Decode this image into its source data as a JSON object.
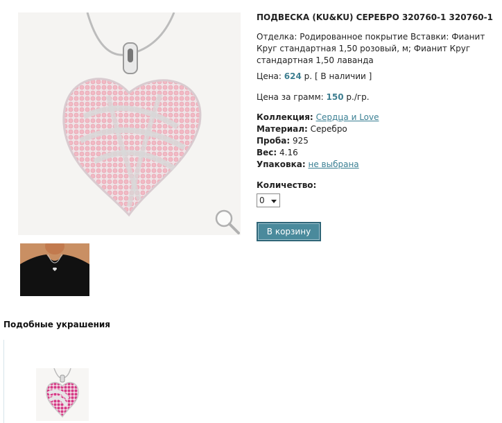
{
  "product": {
    "title": "ПОДВЕСКА (KU&KU) СЕРЕБРО 320760-1 320760-1",
    "description": "Отделка: Родированное покрытие Вставки: Фианит Круг стандартная 1,50 розовый, м; Фианит Круг стандартная 1,50 лаванда",
    "price_label": "Цена:",
    "price_value": "624",
    "price_unit": "р.",
    "availability": "[ В наличии ]",
    "price_gram_label": "Цена за грамм:",
    "price_gram_value": "150",
    "price_gram_unit": "р./гр."
  },
  "details": {
    "collection_label": "Коллекция:",
    "collection_value": "Сердца и Love",
    "material_label": "Материал:",
    "material_value": "Серебро",
    "probe_label": "Проба:",
    "probe_value": "925",
    "weight_label": "Вес:",
    "weight_value": "4.16",
    "packaging_label": "Упаковка:",
    "packaging_value": "не выбрана"
  },
  "order": {
    "quantity_label": "Количество:",
    "quantity_value": "0",
    "cart_button": "В корзину"
  },
  "similar": {
    "title": "Подобные украшения"
  },
  "colors": {
    "accent": "#3f7f91",
    "link": "#3a7f93",
    "button_bg": "#4a8a9c"
  },
  "icons": {
    "zoom": "magnifier-icon"
  }
}
